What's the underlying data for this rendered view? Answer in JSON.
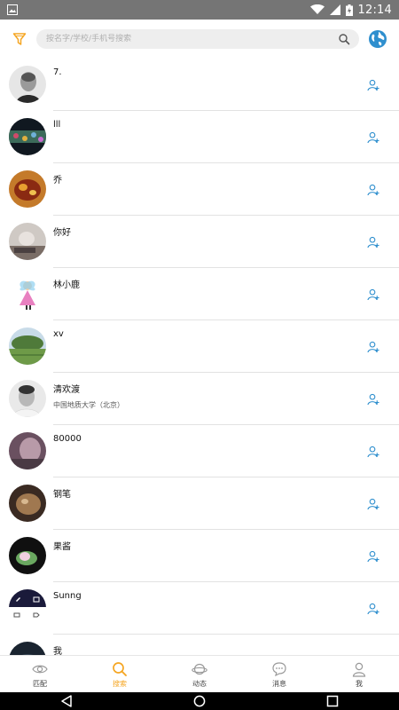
{
  "status_bar": {
    "time": "12:14",
    "battery": "▮"
  },
  "search": {
    "placeholder": "按名字/学校/手机号搜索"
  },
  "colors": {
    "accent": "#f5a623",
    "link_blue": "#2f8fce"
  },
  "users": [
    {
      "name": "7.",
      "subtitle": "",
      "avatar": "a1"
    },
    {
      "name": "lll",
      "subtitle": "",
      "avatar": "a2"
    },
    {
      "name": "乔",
      "subtitle": "",
      "avatar": "a3"
    },
    {
      "name": "你好",
      "subtitle": "",
      "avatar": "a4"
    },
    {
      "name": "林小鹿",
      "subtitle": "",
      "avatar": "a5"
    },
    {
      "name": "xv",
      "subtitle": "",
      "avatar": "a6"
    },
    {
      "name": "清欢渡",
      "subtitle": "中国地质大学（北京）",
      "avatar": "a7"
    },
    {
      "name": "80000",
      "subtitle": "",
      "avatar": "a8"
    },
    {
      "name": "钢笔",
      "subtitle": "",
      "avatar": "a9"
    },
    {
      "name": "果酱",
      "subtitle": "",
      "avatar": "a10"
    },
    {
      "name": "Sunng",
      "subtitle": "",
      "avatar": "a11"
    },
    {
      "name": "我",
      "subtitle": "",
      "avatar": "a12"
    }
  ],
  "tabs": [
    {
      "label": "匹配",
      "icon": "eye-icon",
      "active": false
    },
    {
      "label": "搜索",
      "icon": "search-icon",
      "active": true
    },
    {
      "label": "动态",
      "icon": "planet-icon",
      "active": false
    },
    {
      "label": "消息",
      "icon": "chat-icon",
      "active": false
    },
    {
      "label": "我",
      "icon": "person-icon",
      "active": false
    }
  ]
}
